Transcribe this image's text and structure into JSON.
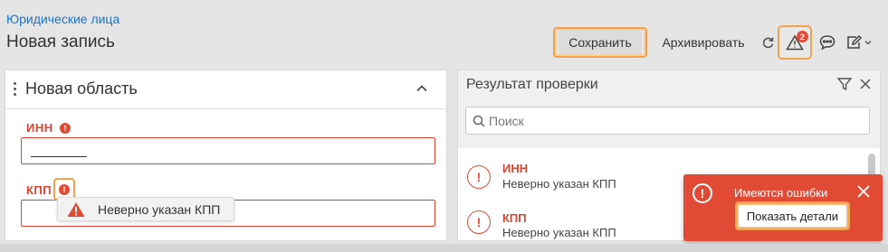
{
  "header": {
    "breadcrumb": "Юридические лица",
    "title": "Новая запись"
  },
  "toolbar": {
    "save_label": "Сохранить",
    "archive_label": "Архивировать",
    "warning_count": "2"
  },
  "left_panel": {
    "title": "Новая область",
    "fields": [
      {
        "label": "ИНН",
        "value": ""
      },
      {
        "label": "КПП",
        "value": ""
      }
    ],
    "tooltip": "Неверно указан КПП"
  },
  "right_panel": {
    "title": "Результат проверки",
    "search_placeholder": "Поиск",
    "results": [
      {
        "field": "ИНН",
        "message": "Неверно указан КПП"
      },
      {
        "field": "КПП",
        "message": "Неверно указан КПП"
      }
    ]
  },
  "toast": {
    "message": "Имеются ошибки",
    "button": "Показать детали"
  },
  "colors": {
    "accent": "#1a73c8",
    "error": "#e14b35",
    "highlight": "#f5a04a",
    "background": "#e5e5e5"
  }
}
